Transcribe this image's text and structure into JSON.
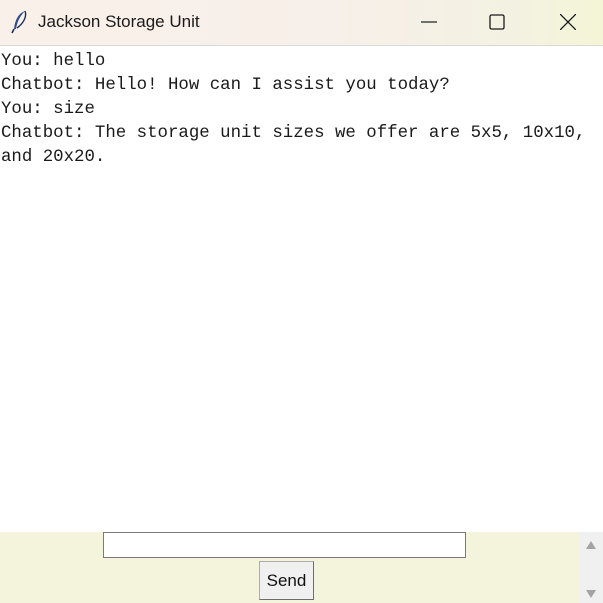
{
  "window": {
    "title": "Jackson Storage Unit",
    "icon": "feather-icon",
    "controls": [
      "minimize-icon",
      "maximize-icon",
      "close-icon"
    ]
  },
  "chat": {
    "lines": [
      "You: hello",
      "Chatbot: Hello! How can I assist you today?",
      "You: size",
      "Chatbot: The storage unit sizes we offer are 5x5, 10x10, and 20x20."
    ]
  },
  "input": {
    "value": "",
    "placeholder": ""
  },
  "send_button": {
    "label": "Send"
  },
  "colors": {
    "bottom_panel": "#f4f3dc",
    "scrollbar": "#f0f0f0",
    "icon_blue": "#2f4f8f"
  }
}
